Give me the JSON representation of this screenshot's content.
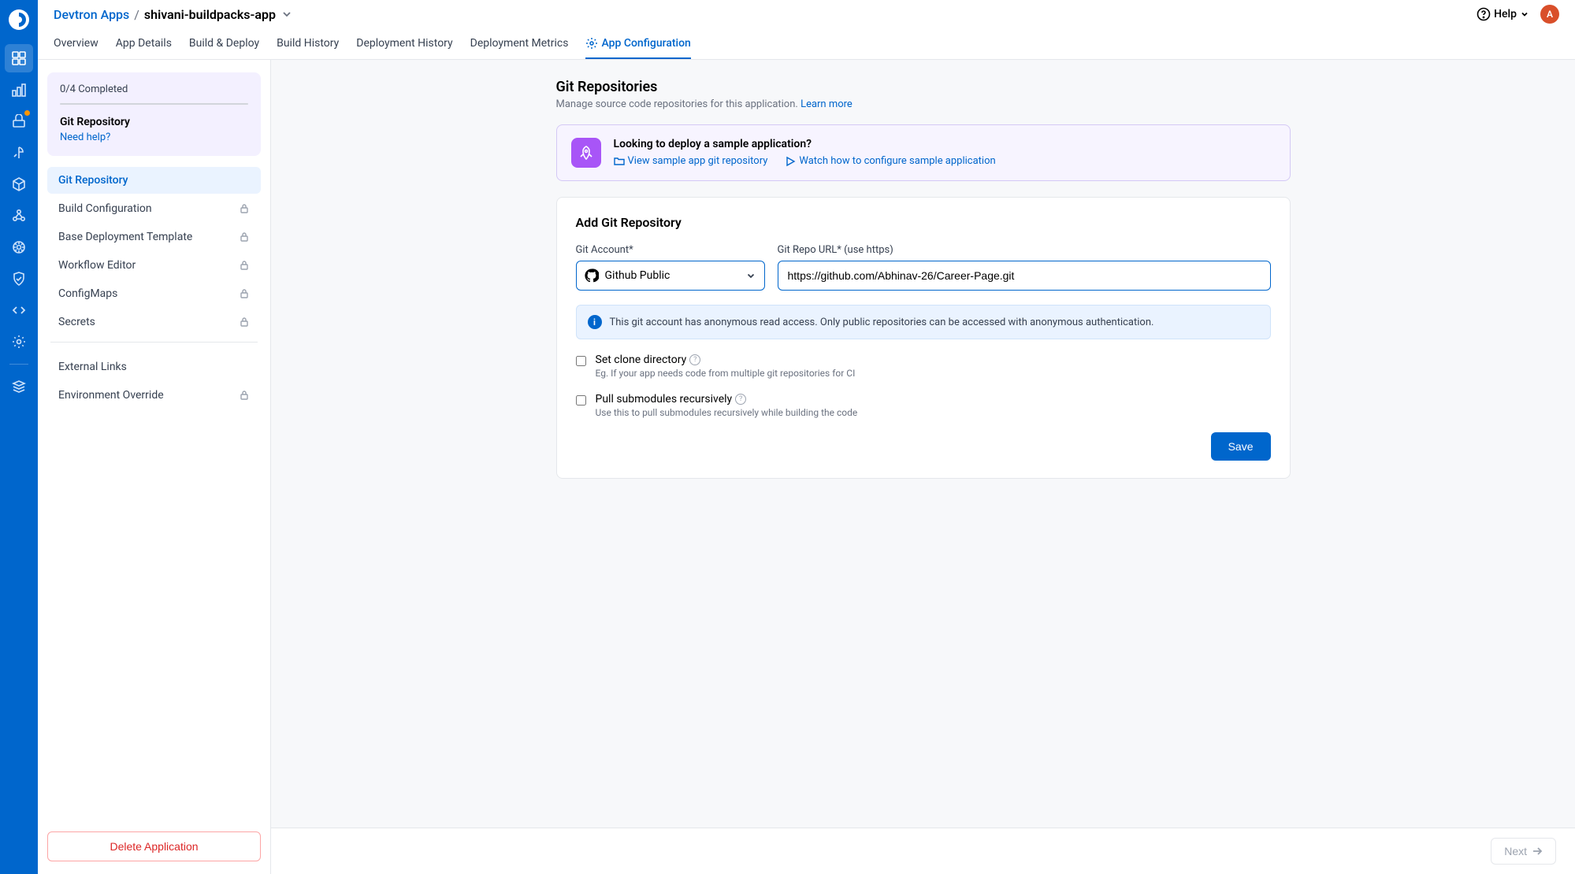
{
  "breadcrumb": {
    "root": "Devtron Apps",
    "sep": "/",
    "current": "shivani-buildpacks-app"
  },
  "topbar": {
    "help": "Help",
    "avatar_initial": "A"
  },
  "tabs": [
    "Overview",
    "App Details",
    "Build & Deploy",
    "Build History",
    "Deployment History",
    "Deployment Metrics",
    "App Configuration"
  ],
  "active_tab": "App Configuration",
  "status": {
    "count": "0/4 Completed",
    "title": "Git Repository",
    "help": "Need help?"
  },
  "side_items": [
    {
      "label": "Git Repository",
      "locked": false,
      "active": true
    },
    {
      "label": "Build Configuration",
      "locked": true
    },
    {
      "label": "Base Deployment Template",
      "locked": true
    },
    {
      "label": "Workflow Editor",
      "locked": true
    },
    {
      "label": "ConfigMaps",
      "locked": true
    },
    {
      "label": "Secrets",
      "locked": true
    }
  ],
  "side_items2": [
    {
      "label": "External Links",
      "locked": false
    },
    {
      "label": "Environment Override",
      "locked": true
    }
  ],
  "delete_label": "Delete Application",
  "page_header": {
    "title": "Git Repositories",
    "sub": "Manage source code repositories for this application.",
    "learn": "Learn more"
  },
  "banner": {
    "title": "Looking to deploy a sample application?",
    "link1": "View sample app git repository",
    "link2": "Watch how to configure sample application"
  },
  "form": {
    "title": "Add Git Repository",
    "account_label": "Git Account*",
    "account_value": "Github Public",
    "url_label": "Git Repo URL* (use https)",
    "url_value": "https://github.com/Abhinav-26/Career-Page.git",
    "info": "This git account has anonymous read access. Only public repositories can be accessed with anonymous authentication.",
    "clone_title": "Set clone directory",
    "clone_sub": "Eg. If your app needs code from multiple git repositories for CI",
    "submod_title": "Pull submodules recursively",
    "submod_sub": "Use this to pull submodules recursively while building the code",
    "save": "Save"
  },
  "footer": {
    "next": "Next"
  }
}
